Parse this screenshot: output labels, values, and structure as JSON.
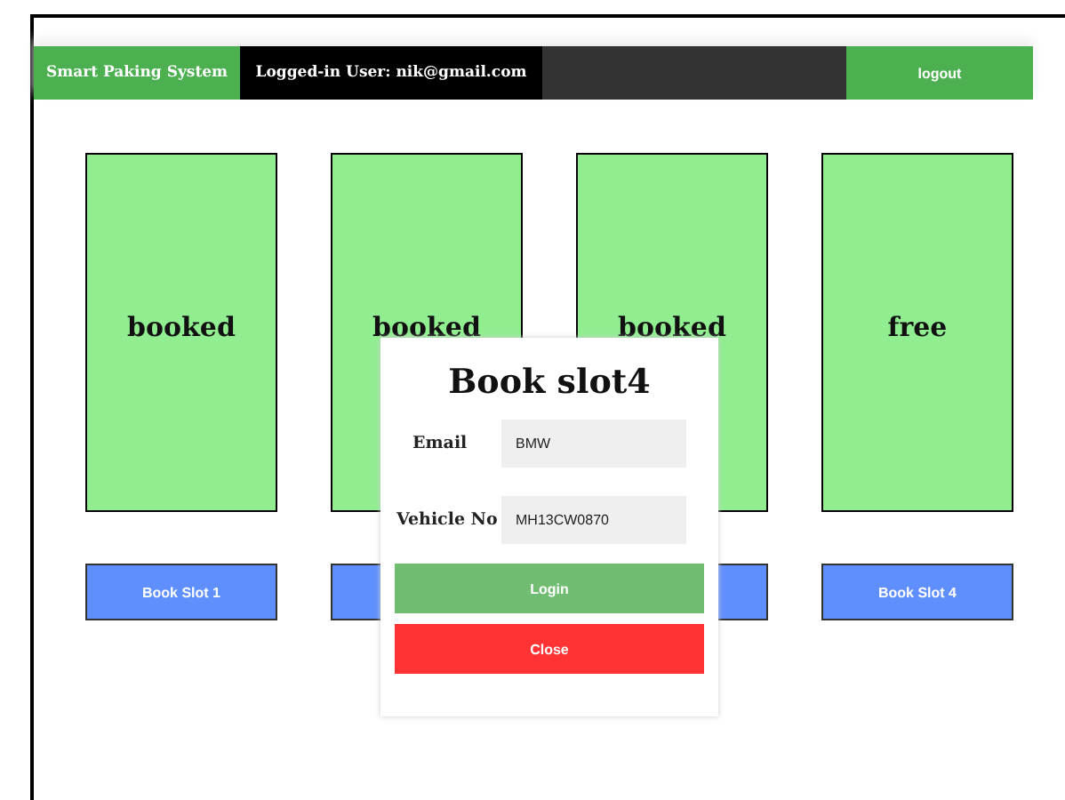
{
  "navbar": {
    "brand": "Smart Paking System",
    "user": "Logged-in User: nik@gmail.com",
    "logout": "logout"
  },
  "slots": [
    {
      "status": "booked",
      "button": "Book Slot 1"
    },
    {
      "status": "booked"
    },
    {
      "status": "booked"
    },
    {
      "status": "free",
      "button": "Book Slot 4"
    }
  ],
  "modal": {
    "title": "Book slot4",
    "fields": [
      {
        "label": "Email",
        "value": "BMW"
      },
      {
        "label": "Vehicle No",
        "value": "MH13CW0870"
      }
    ],
    "login": "Login",
    "close": "Close"
  }
}
